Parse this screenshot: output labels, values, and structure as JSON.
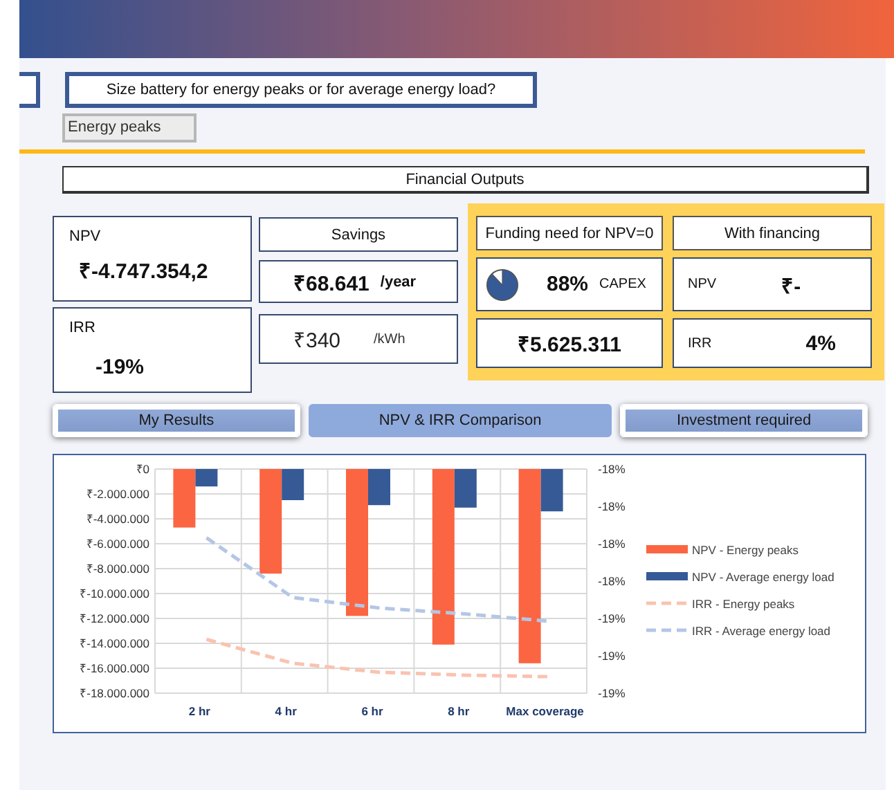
{
  "question": {
    "label": "Size battery for energy peaks or for average energy load?",
    "value": "Energy peaks"
  },
  "section_title": "Financial Outputs",
  "npv": {
    "label": "NPV",
    "value": "₹-4.747.354,2"
  },
  "irr": {
    "label": "IRR",
    "value": "-19%"
  },
  "savings": {
    "label": "Savings",
    "yearly_value": "₹68.641",
    "yearly_unit": "/year",
    "kwh_value": "₹340",
    "kwh_unit": "/kWh"
  },
  "funding": {
    "label": "Funding need for NPV=0",
    "percent": "88%",
    "percent_label": "CAPEX",
    "amount": "₹5.625.311"
  },
  "financing": {
    "label": "With financing",
    "npv_label": "NPV",
    "npv_value": "₹-",
    "irr_label": "IRR",
    "irr_value": "4%"
  },
  "tabs": [
    {
      "label": "My Results",
      "selected": false
    },
    {
      "label": "NPV & IRR Comparison",
      "selected": true
    },
    {
      "label": "Investment required",
      "selected": false
    }
  ],
  "chart": {
    "chart_data": {
      "type": "bar",
      "grid": true,
      "legend": "right",
      "categories": [
        "2 hr",
        "4 hr",
        "6 hr",
        "8 hr",
        "Max coverage"
      ],
      "ylim": [
        -18000000,
        0
      ],
      "yticks": [
        {
          "value": 0,
          "label": "₹0"
        },
        {
          "value": -2000000,
          "label": "₹-2.000.000"
        },
        {
          "value": -4000000,
          "label": "₹-4.000.000"
        },
        {
          "value": -6000000,
          "label": "₹-6.000.000"
        },
        {
          "value": -8000000,
          "label": "₹-8.000.000"
        },
        {
          "value": -10000000,
          "label": "₹-10.000.000"
        },
        {
          "value": -12000000,
          "label": "₹-12.000.000"
        },
        {
          "value": -14000000,
          "label": "₹-14.000.000"
        },
        {
          "value": -16000000,
          "label": "₹-16.000.000"
        },
        {
          "value": -18000000,
          "label": "₹-18.000.000"
        }
      ],
      "y2lim": [
        -19,
        -17.5
      ],
      "y2ticks": [
        {
          "value": -17.5,
          "label": "-18%"
        },
        {
          "value": -17.75,
          "label": "-18%"
        },
        {
          "value": -18,
          "label": "-18%"
        },
        {
          "value": -18.25,
          "label": "-18%"
        },
        {
          "value": -18.5,
          "label": "-19%"
        },
        {
          "value": -18.75,
          "label": "-19%"
        },
        {
          "value": -19,
          "label": "-19%"
        }
      ],
      "series": [
        {
          "name": "NPV - Energy peaks",
          "color": "#fb6541",
          "values": [
            -4700000,
            -8400000,
            -11800000,
            -14100000,
            -15600000
          ]
        },
        {
          "name": "NPV - Average energy load",
          "color": "#355a96",
          "values": [
            -1400000,
            -2500000,
            -2900000,
            -3100000,
            -3400000
          ]
        },
        {
          "name": "IRR - Energy peaks",
          "type": "line",
          "line_style": "dashed",
          "axis": "y2",
          "color": "#f9c3b0",
          "values": [
            -18.64,
            -18.8,
            -18.86,
            -18.88,
            -18.89
          ]
        },
        {
          "name": "IRR - Average energy load",
          "type": "line",
          "line_style": "dashed",
          "axis": "y2",
          "color": "#b4c6e6",
          "values": [
            -17.96,
            -18.36,
            -18.43,
            -18.47,
            -18.52
          ]
        }
      ]
    }
  }
}
